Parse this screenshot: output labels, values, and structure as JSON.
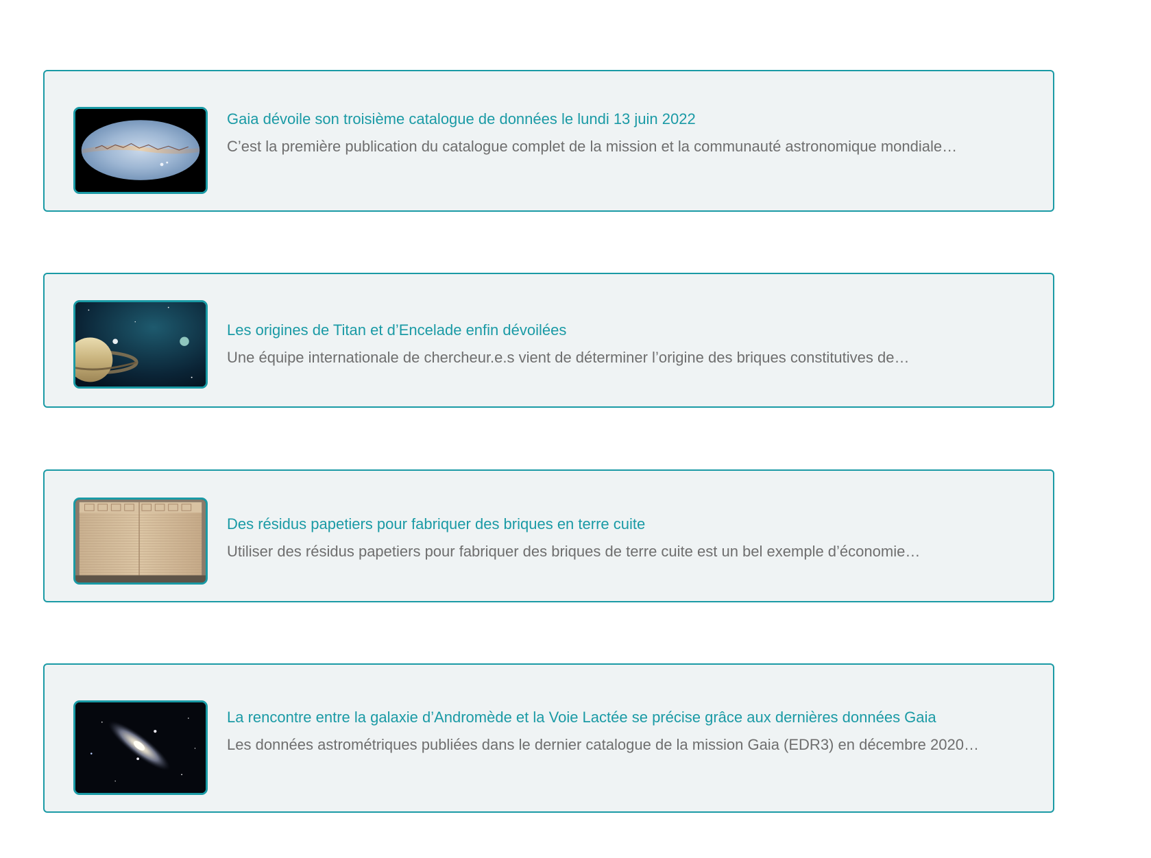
{
  "articles": [
    {
      "title": "Gaia dévoile son troisième catalogue de données le lundi 13 juin 2022",
      "excerpt": "C’est la première publication du catalogue complet de la mission et la communauté astronomique mondiale…",
      "image": "milky-way-all-sky-map-image"
    },
    {
      "title": "Les origines de Titan et d’Encelade enfin dévoilées",
      "excerpt": "Une équipe internationale de chercheur.e.s vient de déterminer l’origine des briques constitutives de…",
      "image": "saturn-moons-image"
    },
    {
      "title": "Des résidus papetiers pour fabriquer des briques en terre cuite",
      "excerpt": "Utiliser des résidus papetiers pour fabriquer des briques de terre cuite est un bel exemple d’économie…",
      "image": "clay-bricks-image"
    },
    {
      "title": "La rencontre entre la galaxie d’Andromède et la Voie Lactée se précise grâce aux dernières données Gaia",
      "excerpt": "Les données astrométriques publiées dans le dernier catalogue de la mission Gaia (EDR3) en décembre 2020…",
      "image": "andromeda-galaxy-image"
    }
  ],
  "colors": {
    "accent": "#1a9aa5",
    "card_background": "#eff3f4",
    "excerpt_text": "#6e6e6e"
  }
}
